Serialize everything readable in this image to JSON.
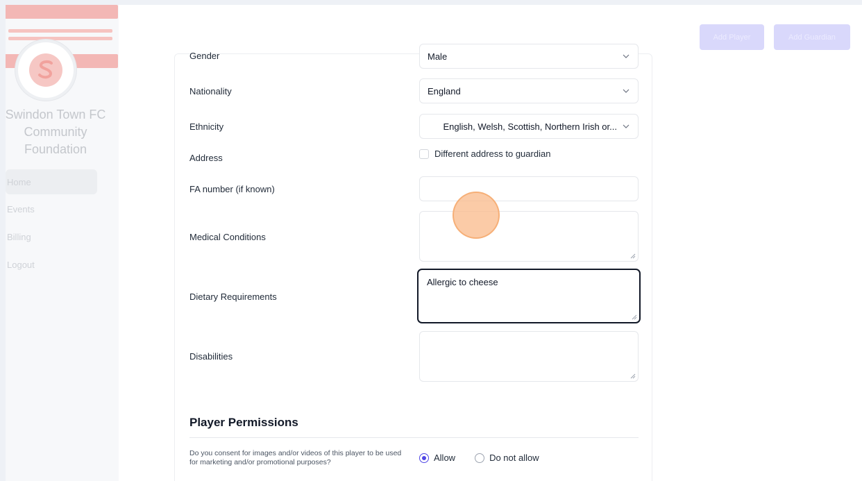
{
  "sidebar": {
    "club_name": "Swindon Town FC Community Foundation",
    "nav": [
      {
        "label": "Home",
        "active": true
      },
      {
        "label": "Events",
        "active": false
      },
      {
        "label": "Billing",
        "active": false
      },
      {
        "label": "Logout",
        "active": false
      }
    ]
  },
  "header": {
    "add_player_label": "Add Player",
    "add_guardian_label": "Add Guardian"
  },
  "form": {
    "gender": {
      "label": "Gender",
      "value": "Male"
    },
    "nationality": {
      "label": "Nationality",
      "value": "England"
    },
    "ethnicity": {
      "label": "Ethnicity",
      "value": "English, Welsh, Scottish, Northern Irish or..."
    },
    "address": {
      "label": "Address",
      "checkbox_label": "Different address to guardian",
      "checked": false
    },
    "fa_number": {
      "label": "FA number (if known)",
      "value": ""
    },
    "medical": {
      "label": "Medical Conditions",
      "value": ""
    },
    "dietary": {
      "label": "Dietary Requirements",
      "value": "Allergic to cheese"
    },
    "disabilities": {
      "label": "Disabilities",
      "value": ""
    }
  },
  "permissions": {
    "title": "Player Permissions",
    "consent_question": "Do you consent for images and/or videos of this player to be used for marketing and/or promotional purposes?",
    "options": [
      {
        "label": "Allow",
        "selected": true
      },
      {
        "label": "Do not allow",
        "selected": false
      }
    ]
  },
  "colors": {
    "accent": "#4f46e5",
    "faded_brand": "#f3b7b5",
    "cursor_highlight": "#fab98a"
  }
}
